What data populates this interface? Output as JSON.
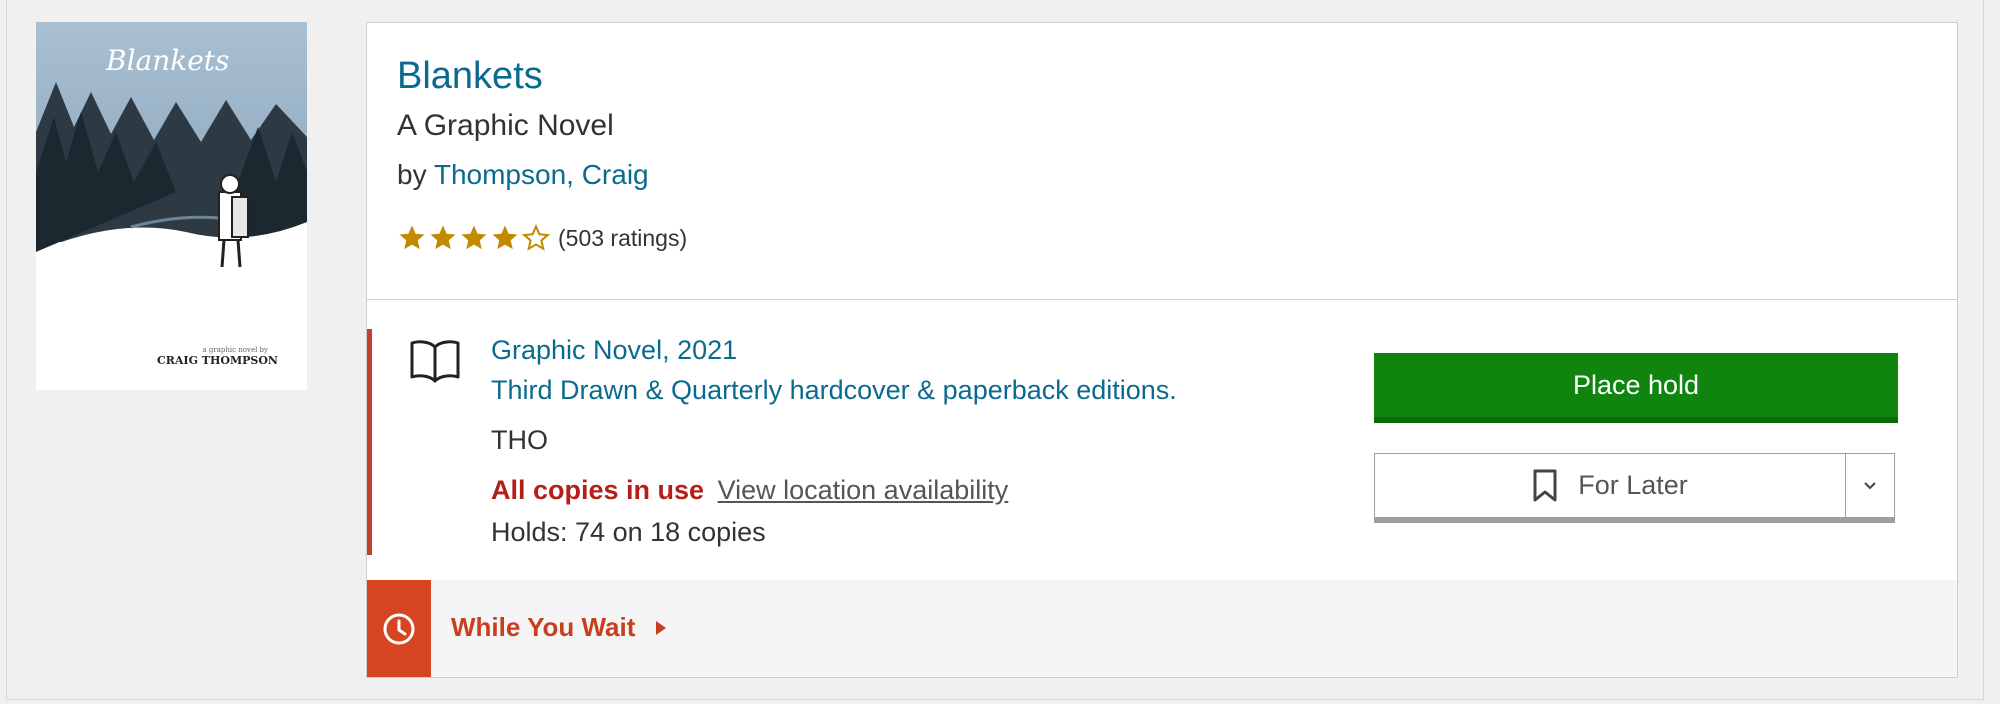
{
  "cover": {
    "title_art": "Blankets",
    "tagline": "a graphic novel by",
    "author_art": "CRAIG THOMPSON"
  },
  "item": {
    "title": "Blankets",
    "subtitle": "A Graphic Novel",
    "by_prefix": "by",
    "author": "Thompson, Craig",
    "rating": {
      "value": 4,
      "max": 5,
      "count_text": "(503 ratings)"
    }
  },
  "edition": {
    "format": "Graphic Novel, 2021",
    "edition_note": "Third Drawn & Quarterly hardcover & paperback editions.",
    "call_number": "THO",
    "status": "All copies in use",
    "availability_link": "View location availability",
    "holds": "Holds: 74 on 18 copies"
  },
  "actions": {
    "place_hold": "Place hold",
    "for_later": "For Later"
  },
  "while_you_wait": {
    "label": "While You Wait"
  },
  "colors": {
    "link": "#0b6a8f",
    "star": "#c28a00",
    "status": "#b51f19",
    "hold_button": "#0f850f",
    "accent": "#d64521"
  }
}
